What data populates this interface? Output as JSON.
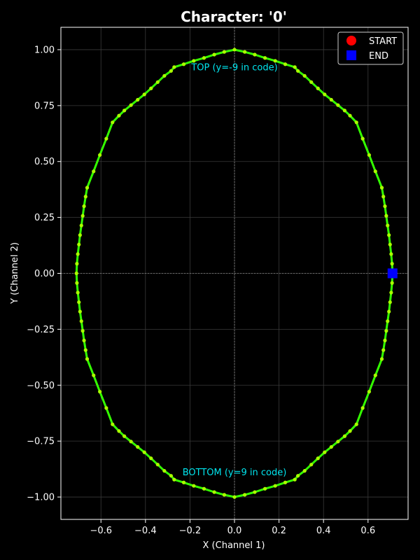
{
  "chart_data": {
    "type": "line",
    "title": "Character: '0'",
    "xlabel": "X (Channel 1)",
    "ylabel": "Y (Channel 2)",
    "xlim": [
      -0.78,
      0.78
    ],
    "ylim": [
      -1.1,
      1.1
    ],
    "grid": true,
    "legend": {
      "position": "top-right",
      "entries": [
        {
          "label": "START",
          "color": "#ff0000",
          "marker": "circle"
        },
        {
          "label": "END",
          "color": "#0000ff",
          "marker": "square"
        }
      ]
    },
    "x_ticks": [
      -0.6,
      -0.4,
      -0.2,
      0.0,
      0.2,
      0.4,
      0.6
    ],
    "x_tick_labels": [
      "−0.6",
      "−0.4",
      "−0.2",
      "0.0",
      "0.2",
      "0.4",
      "0.6"
    ],
    "y_ticks": [
      1.0,
      0.75,
      0.5,
      0.25,
      0.0,
      -0.25,
      -0.5,
      -0.75,
      -1.0
    ],
    "y_tick_labels": [
      "1.00",
      "0.75",
      "0.50",
      "0.25",
      "0.00",
      "−0.25",
      "−0.50",
      "−0.75",
      "−1.00"
    ],
    "annotations": [
      {
        "text": "TOP (y=-9 in code)",
        "x": 0.0,
        "y": 0.92,
        "color": "#00e5ee"
      },
      {
        "text": "BOTTOM (y=9 in code)",
        "x": 0.0,
        "y": -0.89,
        "color": "#00e5ee"
      }
    ],
    "series": [
      {
        "color": "#33ff00",
        "x": [
          0.71,
          0.708,
          0.704,
          0.699,
          0.694,
          0.688,
          0.682,
          0.676,
          0.669,
          0.662,
          0.633,
          0.605,
          0.576,
          0.548,
          0.519,
          0.495,
          0.465,
          0.435,
          0.405,
          0.375,
          0.345,
          0.315,
          0.285,
          0.271,
          0.228,
          0.183,
          0.137,
          0.091,
          0.046,
          0.0,
          -0.046,
          -0.091,
          -0.137,
          -0.183,
          -0.228,
          -0.271,
          -0.285,
          -0.315,
          -0.345,
          -0.375,
          -0.405,
          -0.435,
          -0.465,
          -0.495,
          -0.519,
          -0.548,
          -0.576,
          -0.605,
          -0.633,
          -0.662,
          -0.669,
          -0.676,
          -0.682,
          -0.688,
          -0.694,
          -0.699,
          -0.704,
          -0.708,
          -0.71,
          -0.708,
          -0.704,
          -0.699,
          -0.694,
          -0.688,
          -0.682,
          -0.676,
          -0.669,
          -0.662,
          -0.633,
          -0.605,
          -0.576,
          -0.548,
          -0.519,
          -0.495,
          -0.465,
          -0.435,
          -0.405,
          -0.375,
          -0.345,
          -0.315,
          -0.285,
          -0.271,
          -0.228,
          -0.183,
          -0.137,
          -0.091,
          -0.046,
          0.0,
          0.046,
          0.091,
          0.137,
          0.183,
          0.228,
          0.271,
          0.285,
          0.315,
          0.345,
          0.375,
          0.405,
          0.435,
          0.465,
          0.495,
          0.519,
          0.548,
          0.576,
          0.605,
          0.633,
          0.662,
          0.669,
          0.676,
          0.682,
          0.688,
          0.694,
          0.699,
          0.704,
          0.708,
          0.71
        ],
        "y": [
          0.0,
          0.043,
          0.086,
          0.129,
          0.171,
          0.214,
          0.257,
          0.3,
          0.343,
          0.383,
          0.456,
          0.529,
          0.602,
          0.675,
          0.705,
          0.728,
          0.752,
          0.776,
          0.8,
          0.827,
          0.855,
          0.883,
          0.905,
          0.922,
          0.935,
          0.95,
          0.963,
          0.978,
          0.99,
          1.0,
          0.99,
          0.978,
          0.963,
          0.95,
          0.935,
          0.922,
          0.905,
          0.883,
          0.855,
          0.827,
          0.8,
          0.776,
          0.752,
          0.728,
          0.705,
          0.675,
          0.602,
          0.529,
          0.456,
          0.383,
          0.343,
          0.3,
          0.257,
          0.214,
          0.171,
          0.129,
          0.086,
          0.043,
          0.0,
          -0.043,
          -0.086,
          -0.129,
          -0.171,
          -0.214,
          -0.257,
          -0.3,
          -0.343,
          -0.383,
          -0.456,
          -0.529,
          -0.602,
          -0.675,
          -0.705,
          -0.728,
          -0.752,
          -0.776,
          -0.8,
          -0.827,
          -0.855,
          -0.883,
          -0.905,
          -0.922,
          -0.935,
          -0.95,
          -0.963,
          -0.978,
          -0.99,
          -1.0,
          -0.99,
          -0.978,
          -0.963,
          -0.95,
          -0.935,
          -0.922,
          -0.905,
          -0.883,
          -0.855,
          -0.827,
          -0.8,
          -0.776,
          -0.752,
          -0.728,
          -0.705,
          -0.675,
          -0.602,
          -0.529,
          -0.456,
          -0.383,
          -0.343,
          -0.3,
          -0.257,
          -0.214,
          -0.171,
          -0.129,
          -0.086,
          -0.043,
          0.0
        ]
      }
    ],
    "start_point": {
      "x": 0.71,
      "y": 0.0
    },
    "end_point": {
      "x": 0.71,
      "y": 0.0
    }
  }
}
